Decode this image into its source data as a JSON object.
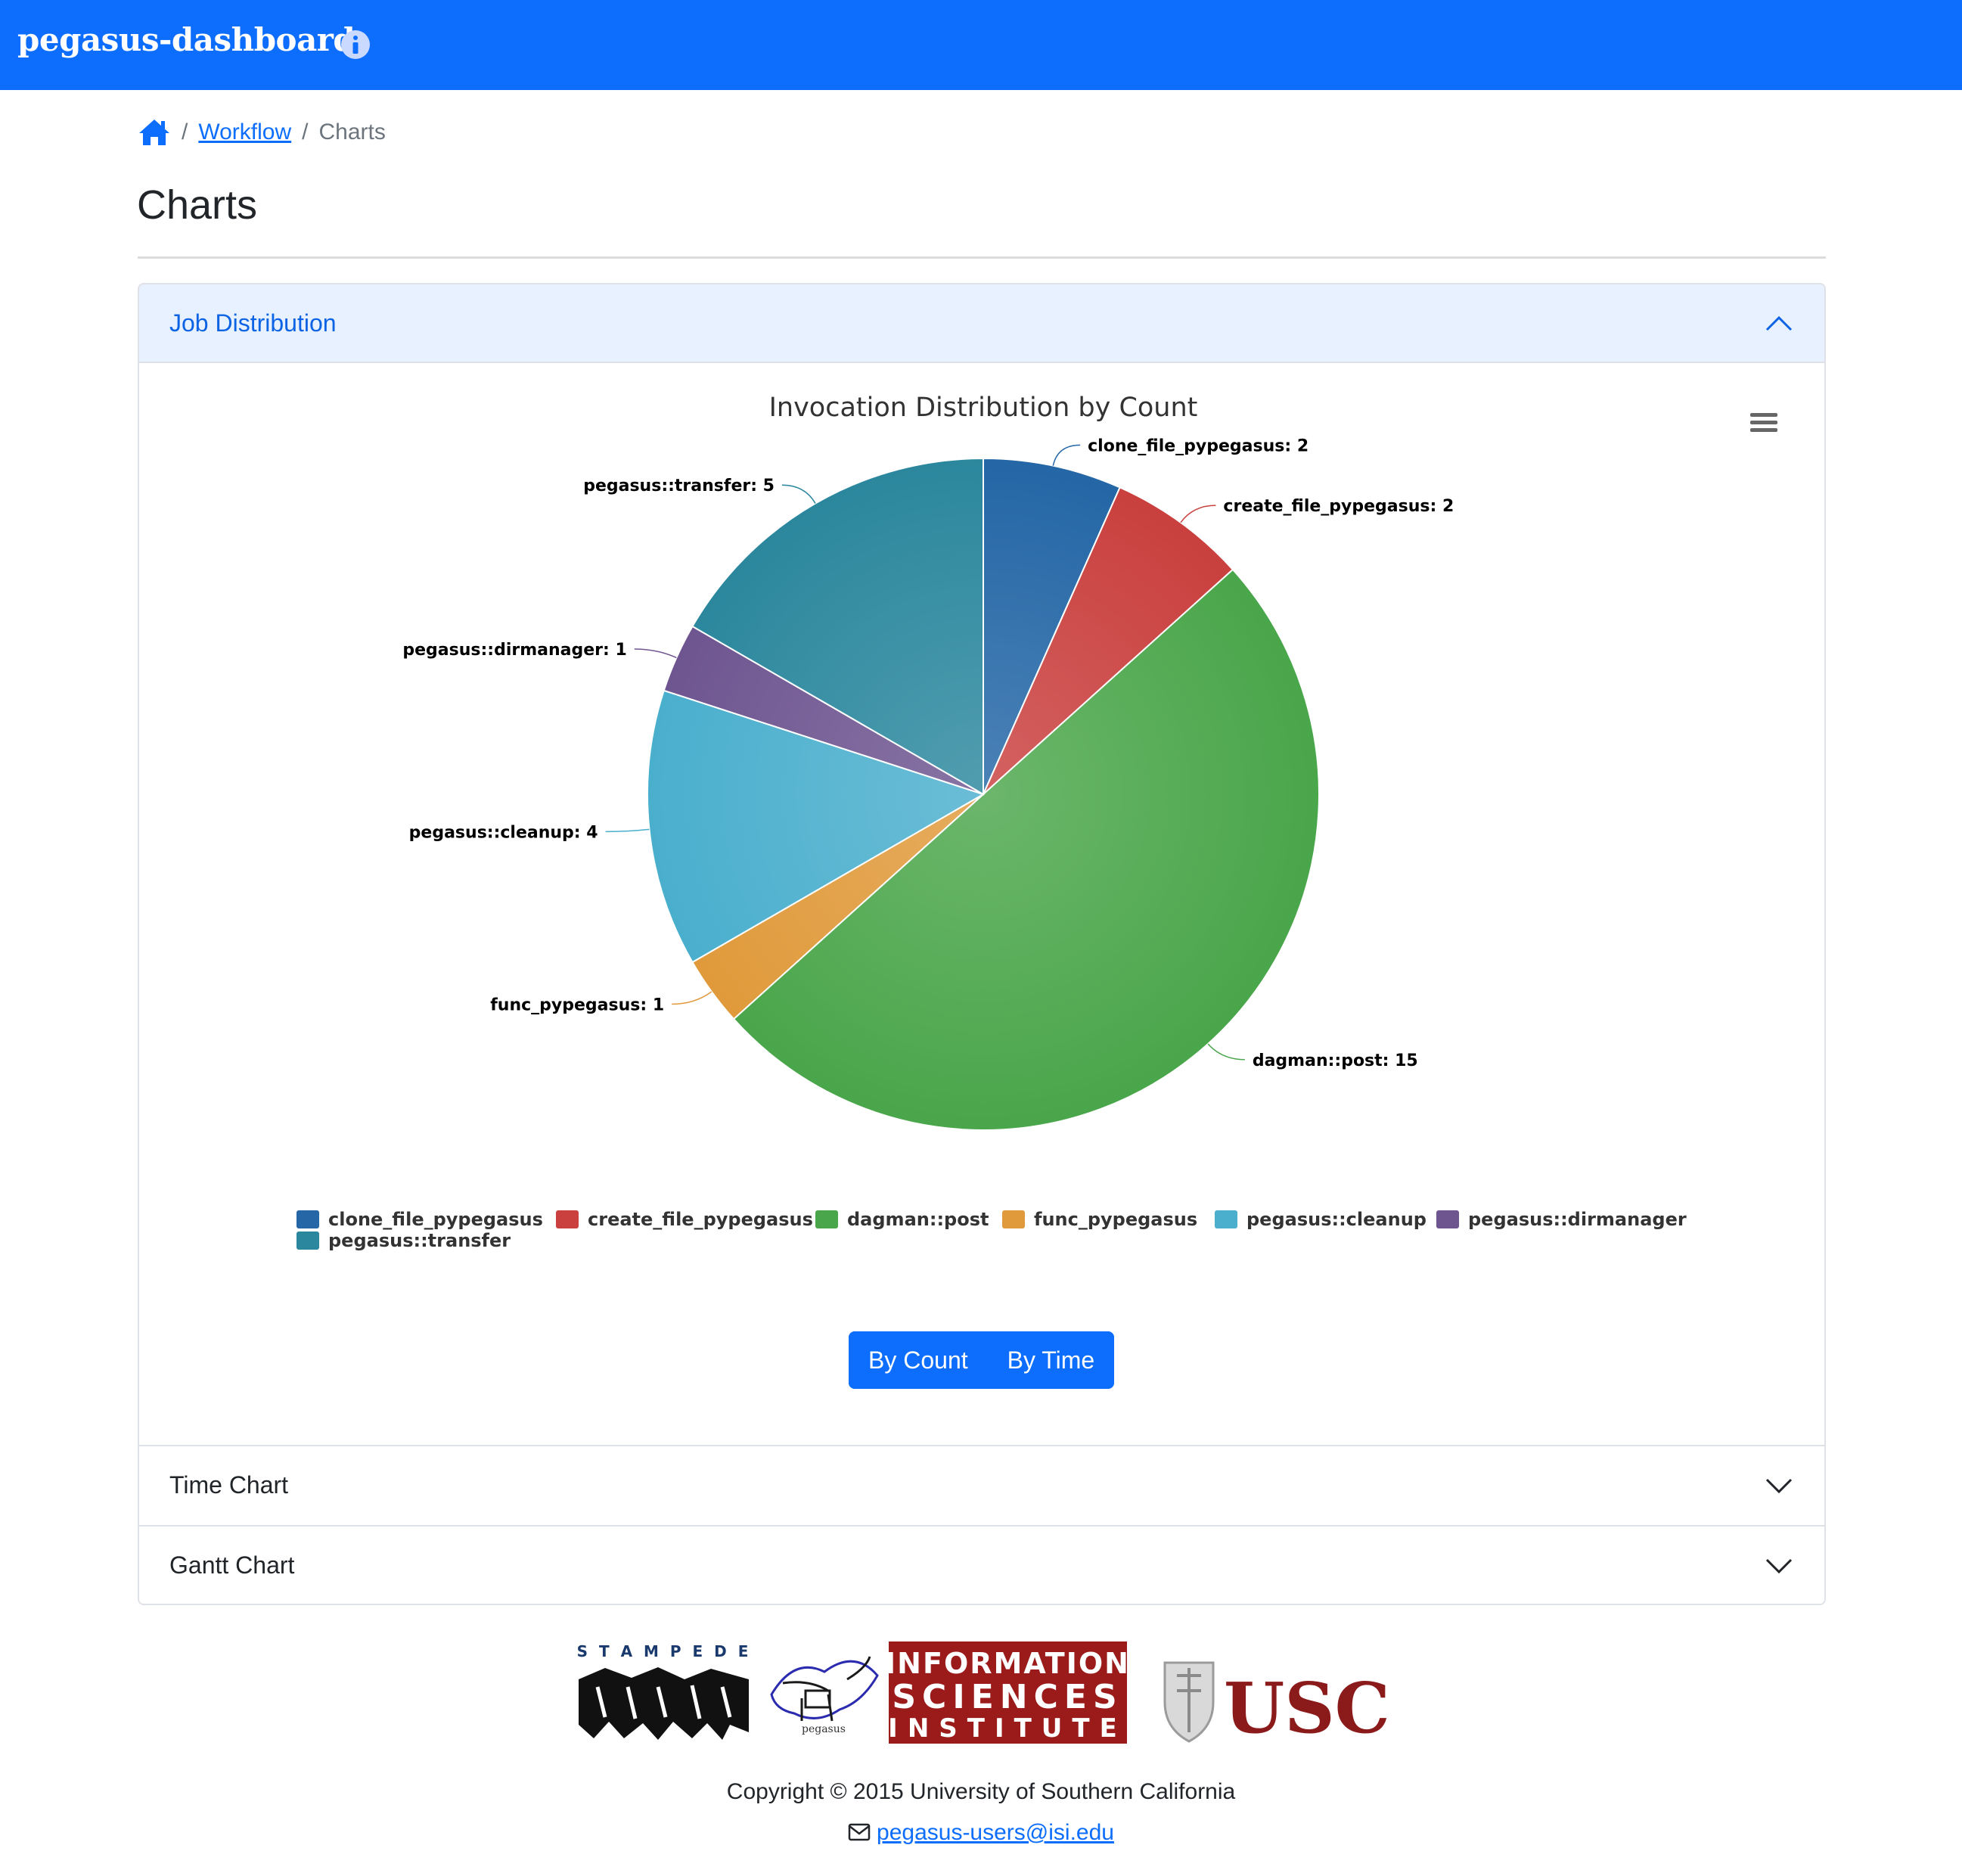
{
  "navbar": {
    "brand": "pegasus-dashboard",
    "info_icon": "info-circle-icon",
    "color": "#0d6efd"
  },
  "breadcrumb": {
    "home_icon": "home-icon",
    "link": "Workflow",
    "active": "Charts",
    "separator": "/"
  },
  "page": {
    "title": "Charts"
  },
  "accordion": {
    "sections": [
      {
        "label": "Job Distribution",
        "expanded": true
      },
      {
        "label": "Time Chart",
        "expanded": false
      },
      {
        "label": "Gantt Chart",
        "expanded": false
      }
    ]
  },
  "chart_data": {
    "type": "pie",
    "title": "Invocation Distribution by Count",
    "categories": [
      "clone_file_pypegasus",
      "create_file_pypegasus",
      "dagman::post",
      "func_pypegasus",
      "pegasus::cleanup",
      "pegasus::dirmanager",
      "pegasus::transfer"
    ],
    "values": [
      2,
      2,
      15,
      1,
      4,
      1,
      5
    ],
    "colors": [
      "#2466a6",
      "#c9403e",
      "#4aa64a",
      "#e09a3b",
      "#4aafcd",
      "#6e5590",
      "#2b879d"
    ],
    "data_labels": [
      "clone_file_pypegasus: 2",
      "create_file_pypegasus: 2",
      "dagman::post: 15",
      "func_pypegasus: 1",
      "pegasus::cleanup: 4",
      "pegasus::dirmanager: 1",
      "pegasus::transfer: 5"
    ],
    "legend_position": "bottom",
    "menu_icon": "hamburger-menu-icon"
  },
  "toggle": {
    "by_count": "By Count",
    "by_time": "By Time"
  },
  "footer": {
    "logos": {
      "stampede": "S T A M P E D E",
      "pegasus": "pegasus",
      "isi": [
        "INFORMATION",
        "SCIENCES",
        "INSTITUTE"
      ],
      "usc": "USC"
    },
    "copyright": "Copyright © 2015 University of Southern California",
    "email": "pegasus-users@isi.edu",
    "email_icon": "envelope-icon"
  }
}
